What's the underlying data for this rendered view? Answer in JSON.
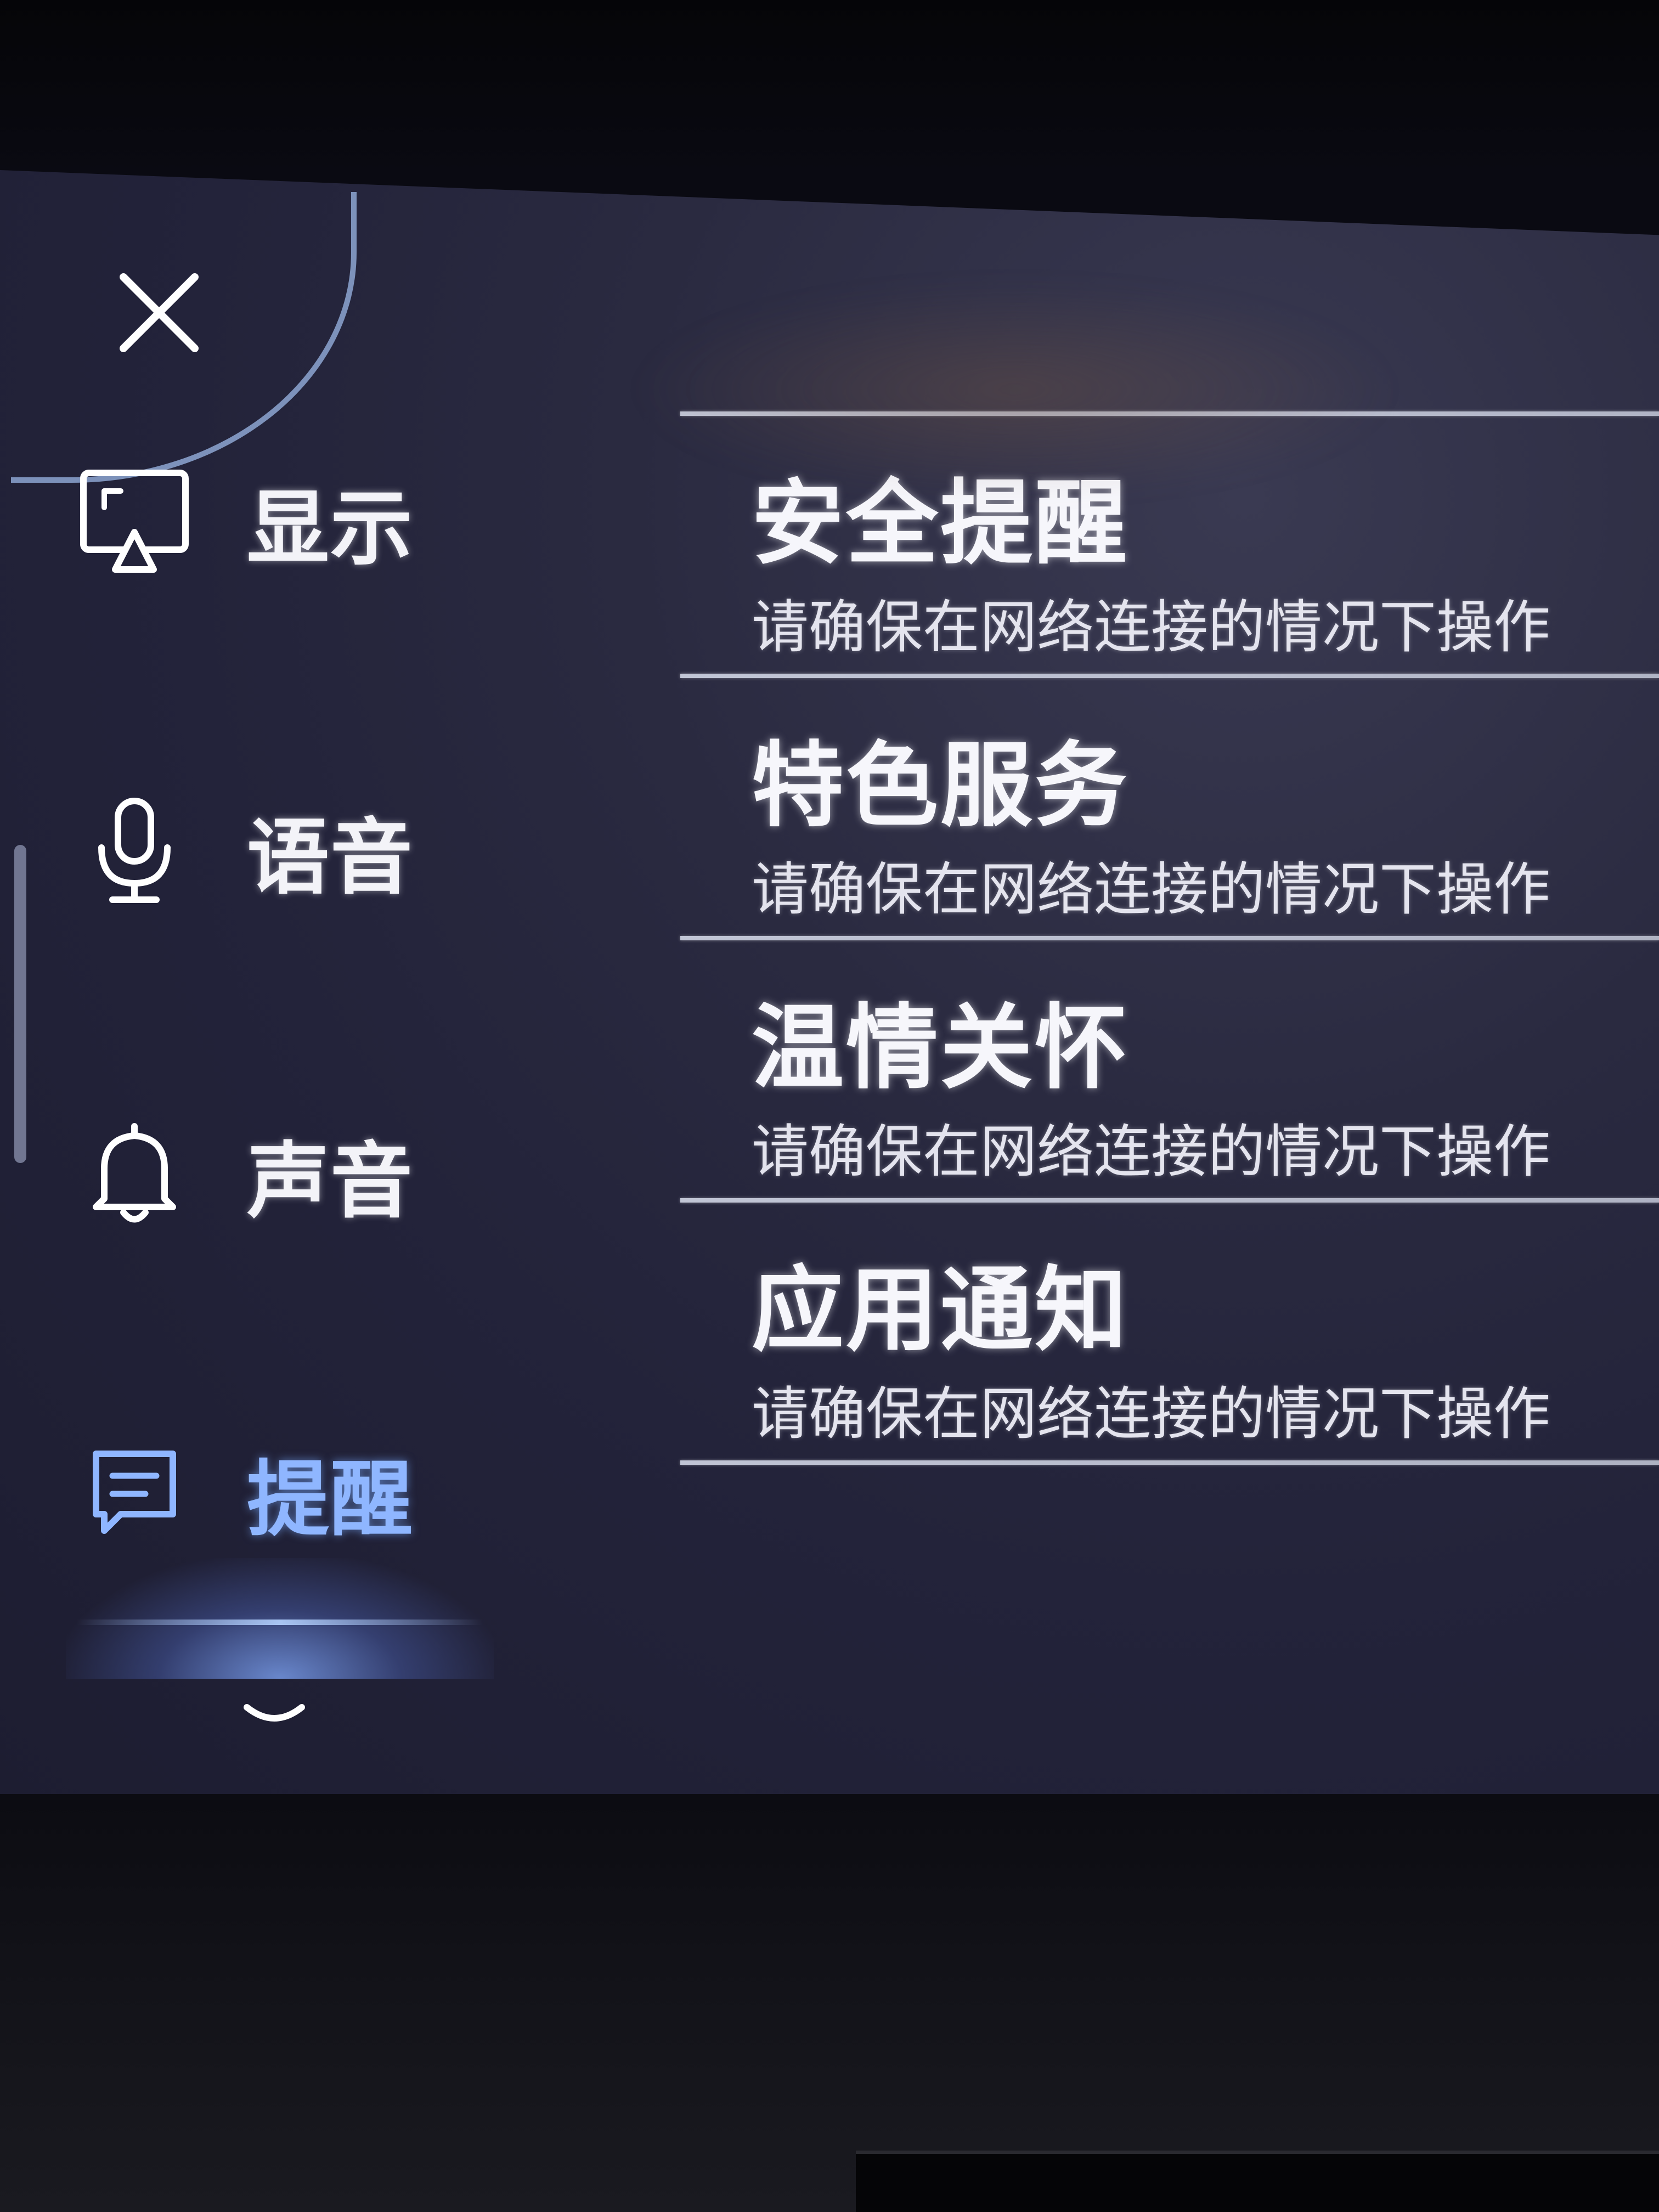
{
  "sidebar": {
    "close_icon": "close-icon",
    "items": [
      {
        "id": "display",
        "label": "显示",
        "icon": "display-screen-icon",
        "active": false
      },
      {
        "id": "voice",
        "label": "语音",
        "icon": "microphone-icon",
        "active": false
      },
      {
        "id": "sound",
        "label": "声音",
        "icon": "bell-icon",
        "active": false
      },
      {
        "id": "reminder",
        "label": "提醒",
        "icon": "message-icon",
        "active": true
      }
    ],
    "more_icon": "chevron-down-icon"
  },
  "list": {
    "items": [
      {
        "title": "安全提醒",
        "subtitle": "请确保在网络连接的情况下操作"
      },
      {
        "title": "特色服务",
        "subtitle": "请确保在网络连接的情况下操作"
      },
      {
        "title": "温情关怀",
        "subtitle": "请确保在网络连接的情况下操作"
      },
      {
        "title": "应用通知",
        "subtitle": "请确保在网络连接的情况下操作"
      }
    ]
  },
  "colors": {
    "accent": "#8fb6ff",
    "text": "#f3f3f8",
    "background": "#23233a"
  }
}
